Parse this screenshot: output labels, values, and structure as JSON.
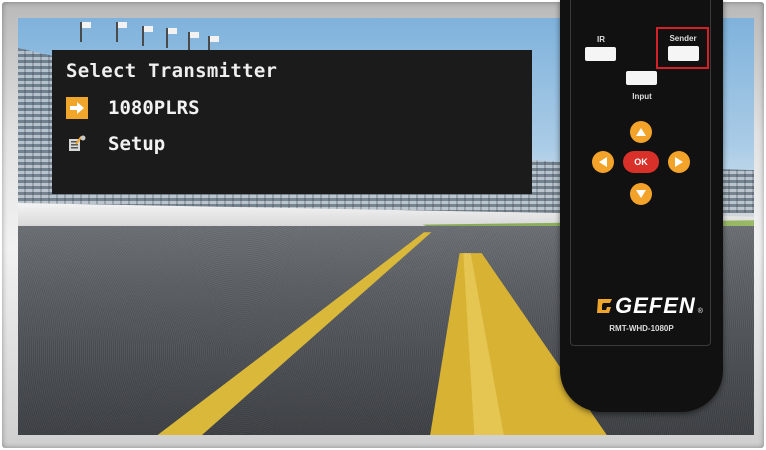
{
  "menu": {
    "title": "Select Transmitter",
    "items": [
      {
        "label": "1080PLRS",
        "icon": "arrow-right-icon",
        "selected": true
      },
      {
        "label": "Setup",
        "icon": "setup-icon",
        "selected": false
      }
    ]
  },
  "remote": {
    "ir_label": "IR",
    "sender_label": "Sender",
    "input_label": "Input",
    "ok_label": "OK",
    "brand": "GEFEN",
    "registered": "®",
    "model": "RMT-WHD-1080P"
  },
  "colors": {
    "osd_background": "#1b1b1b",
    "accent_orange": "#f0a62b",
    "highlight_red": "#d62027",
    "ok_red": "#d9302a"
  }
}
